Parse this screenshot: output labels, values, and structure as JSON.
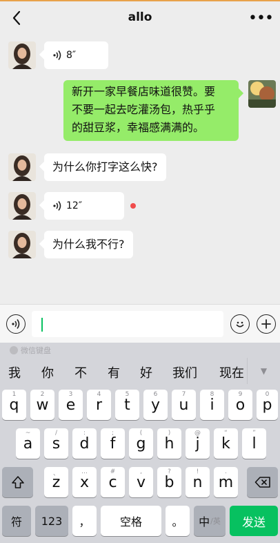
{
  "header": {
    "title": "allo",
    "more_label": "•••"
  },
  "messages": [
    {
      "side": "in",
      "type": "voice",
      "duration": "8″"
    },
    {
      "side": "out",
      "type": "text",
      "lines": [
        "新开一家早餐店味道很赞。要",
        "不要一起去吃灌汤包，热乎乎",
        "的甜豆浆，幸福感满满的。"
      ]
    },
    {
      "side": "in",
      "type": "text",
      "text": "为什么你打字这么快?"
    },
    {
      "side": "in",
      "type": "voice",
      "duration": "12″",
      "unread": true
    },
    {
      "side": "in",
      "type": "text",
      "text": "为什么我不行?"
    }
  ],
  "input": {
    "value": ""
  },
  "keyboard": {
    "brand_label": "微信键盘",
    "candidates": [
      "我",
      "你",
      "不",
      "有",
      "好",
      "我们",
      "现在"
    ],
    "row1": [
      {
        "k": "q",
        "h": "1"
      },
      {
        "k": "w",
        "h": "2"
      },
      {
        "k": "e",
        "h": "3"
      },
      {
        "k": "r",
        "h": "4"
      },
      {
        "k": "t",
        "h": "5"
      },
      {
        "k": "y",
        "h": "6"
      },
      {
        "k": "u",
        "h": "7"
      },
      {
        "k": "i",
        "h": "8"
      },
      {
        "k": "o",
        "h": "9"
      },
      {
        "k": "p",
        "h": "0"
      }
    ],
    "row2": [
      {
        "k": "a",
        "h": "~"
      },
      {
        "k": "s",
        "h": "/"
      },
      {
        "k": "d",
        "h": ":"
      },
      {
        "k": "f",
        "h": ";"
      },
      {
        "k": "g",
        "h": "("
      },
      {
        "k": "h",
        "h": ")"
      },
      {
        "k": "j",
        "h": "@"
      },
      {
        "k": "k",
        "h": "“"
      },
      {
        "k": "l",
        "h": "”"
      }
    ],
    "row3": [
      {
        "k": "z",
        "h": "、"
      },
      {
        "k": "x",
        "h": "…"
      },
      {
        "k": "c",
        "h": "#"
      },
      {
        "k": "v",
        "h": ","
      },
      {
        "k": "b",
        "h": "?"
      },
      {
        "k": "n",
        "h": "!"
      },
      {
        "k": "m",
        "h": "."
      }
    ],
    "symbol_label": "符",
    "numbers_label": "123",
    "comma_label": "，",
    "space_label": "空格",
    "period_label": "。",
    "lang_main": "中",
    "lang_sub": "/英",
    "send_label": "发送"
  },
  "colors": {
    "send": "#07c160",
    "out_bubble": "#95ec69",
    "unread": "#f04c4c"
  }
}
